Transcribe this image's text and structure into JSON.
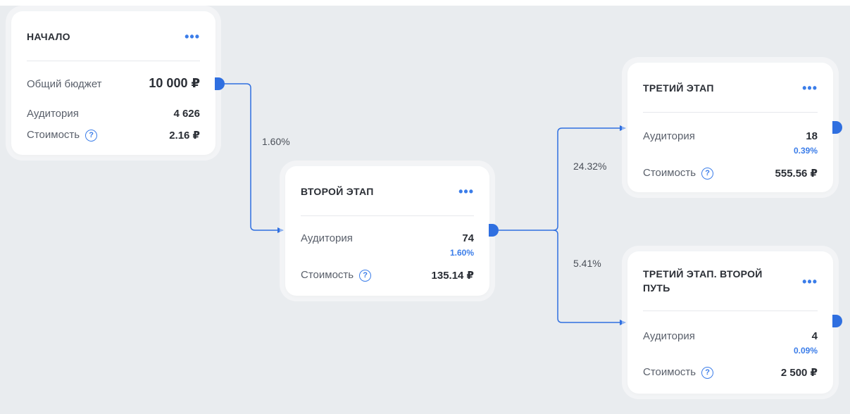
{
  "colors": {
    "accent": "#3b7de9",
    "connector": "#2f6fe0",
    "background": "#e9ecef",
    "card": "#ffffff"
  },
  "nodes": {
    "start": {
      "title": "НАЧАЛО",
      "menu_icon": "ellipsis-icon",
      "budget_label": "Общий бюджет",
      "budget_value": "10 000 ₽",
      "audience_label": "Аудитория",
      "audience_value": "4 626",
      "cost_label": "Стоимость",
      "cost_value": "2.16 ₽"
    },
    "second": {
      "title": "ВТОРОЙ ЭТАП",
      "audience_label": "Аудитория",
      "audience_value": "74",
      "audience_pct": "1.60%",
      "cost_label": "Стоимость",
      "cost_value": "135.14 ₽"
    },
    "third": {
      "title": "ТРЕТИЙ ЭТАП",
      "audience_label": "Аудитория",
      "audience_value": "18",
      "audience_pct": "0.39%",
      "cost_label": "Стоимость",
      "cost_value": "555.56 ₽"
    },
    "third_alt": {
      "title_line1": "ТРЕТИЙ ЭТАП. ВТОРОЙ",
      "title_line2": "ПУТЬ",
      "audience_label": "Аудитория",
      "audience_value": "4",
      "audience_pct": "0.09%",
      "cost_label": "Стоимость",
      "cost_value": "2 500 ₽"
    }
  },
  "edges": {
    "start_to_second": "1.60%",
    "second_to_third": "24.32%",
    "second_to_third_alt": "5.41%"
  },
  "icons": {
    "help": "?",
    "menu": "•••"
  }
}
